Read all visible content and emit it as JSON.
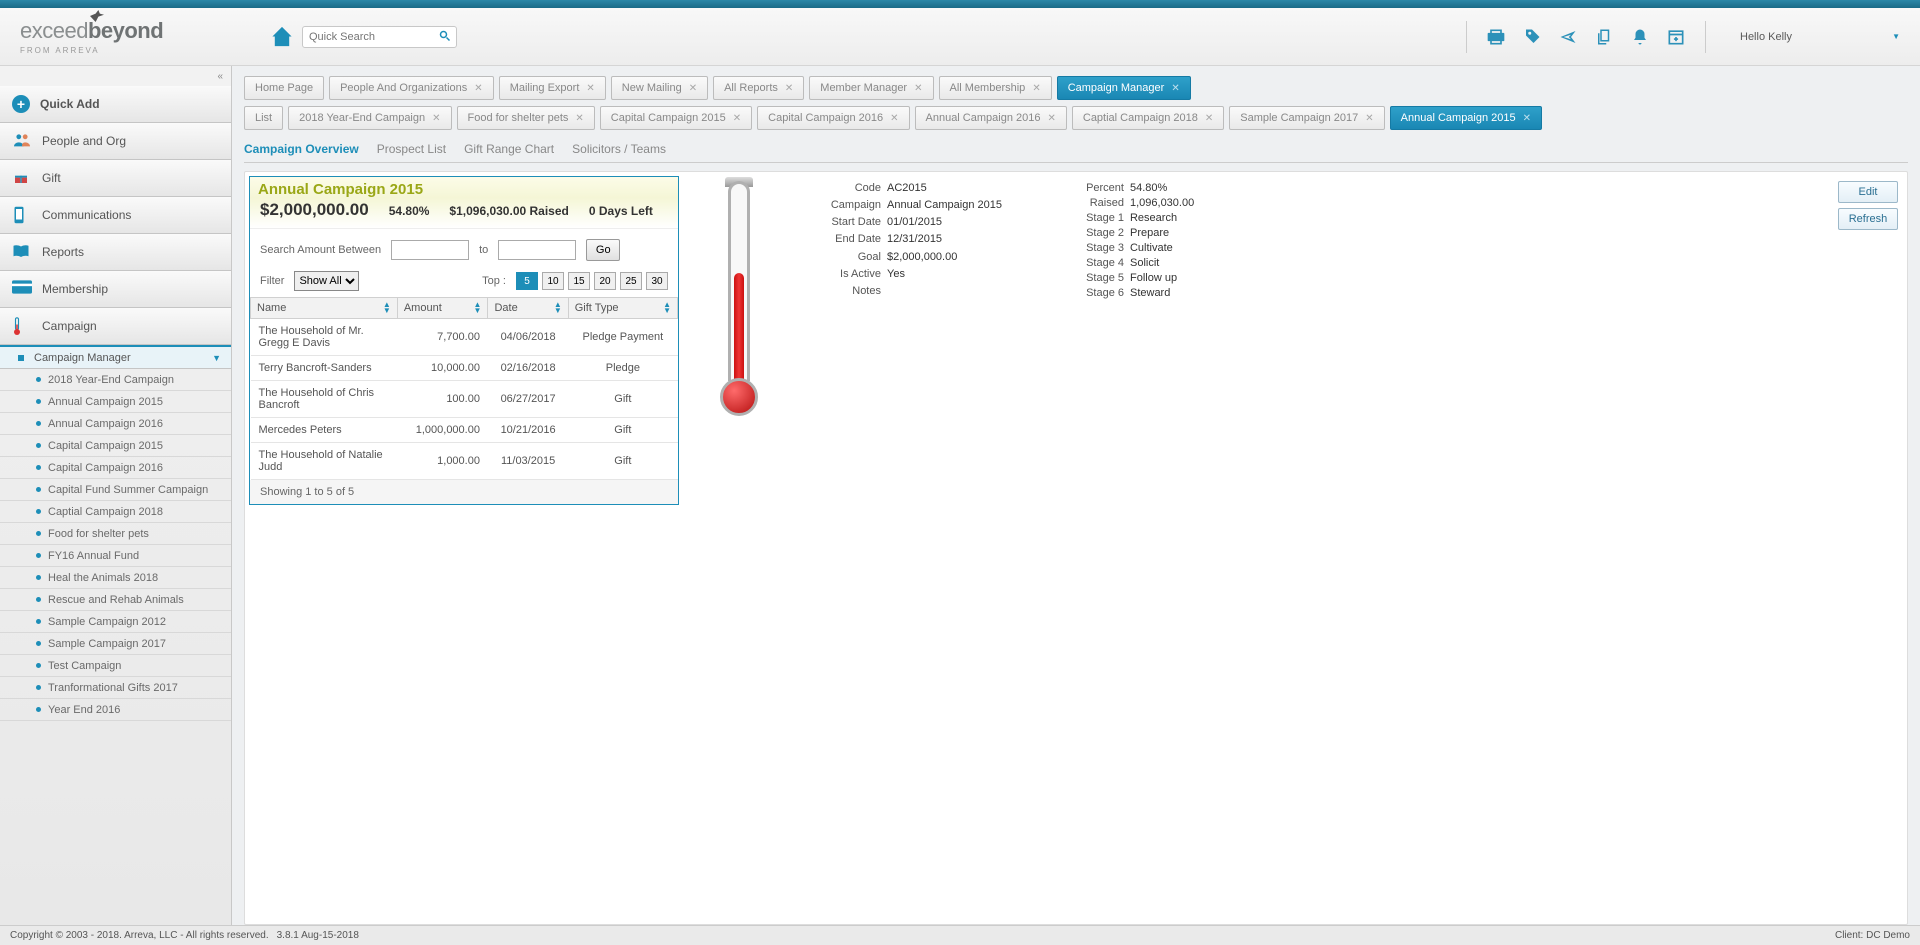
{
  "header": {
    "logo_main_a": "exceed",
    "logo_main_b": "beyond",
    "logo_sub": "FROM ARREVA",
    "search_placeholder": "Quick Search",
    "user_greeting": "Hello Kelly"
  },
  "sidebar": {
    "quick_add": "Quick Add",
    "items": [
      {
        "label": "People and Org"
      },
      {
        "label": "Gift"
      },
      {
        "label": "Communications"
      },
      {
        "label": "Reports"
      },
      {
        "label": "Membership"
      },
      {
        "label": "Campaign"
      }
    ],
    "subnav_header": "Campaign Manager",
    "subnav": [
      "2018 Year-End Campaign",
      "Annual Campaign 2015",
      "Annual Campaign 2016",
      "Capital Campaign 2015",
      "Capital Campaign 2016",
      "Capital Fund Summer Campaign",
      "Captial Campaign 2018",
      "Food for shelter pets",
      "FY16 Annual Fund",
      "Heal the Animals 2018",
      "Rescue and Rehab Animals",
      "Sample Campaign 2012",
      "Sample Campaign 2017",
      "Test Campaign",
      "Tranformational Gifts 2017",
      "Year End 2016"
    ]
  },
  "top_tabs": [
    {
      "label": "Home Page",
      "closable": false
    },
    {
      "label": "People And Organizations",
      "closable": true
    },
    {
      "label": "Mailing Export",
      "closable": true
    },
    {
      "label": "New Mailing",
      "closable": true
    },
    {
      "label": "All Reports",
      "closable": true
    },
    {
      "label": "Member Manager",
      "closable": true
    },
    {
      "label": "All Membership",
      "closable": true
    },
    {
      "label": "Campaign Manager",
      "closable": true,
      "active": true
    }
  ],
  "sub_tabs": [
    {
      "label": "List",
      "closable": false
    },
    {
      "label": "2018 Year-End Campaign",
      "closable": true
    },
    {
      "label": "Food for shelter pets",
      "closable": true
    },
    {
      "label": "Capital Campaign 2015",
      "closable": true
    },
    {
      "label": "Capital Campaign 2016",
      "closable": true
    },
    {
      "label": "Annual Campaign 2016",
      "closable": true
    },
    {
      "label": "Captial Campaign 2018",
      "closable": true
    },
    {
      "label": "Sample Campaign 2017",
      "closable": true
    },
    {
      "label": "Annual Campaign 2015",
      "closable": true,
      "active": true
    }
  ],
  "inner_tabs": [
    {
      "label": "Campaign Overview",
      "active": true
    },
    {
      "label": "Prospect List"
    },
    {
      "label": "Gift Range Chart"
    },
    {
      "label": "Solicitors / Teams"
    }
  ],
  "overview": {
    "title": "Annual Campaign 2015",
    "goal": "$2,000,000.00",
    "percent": "54.80%",
    "raised": "$1,096,030.00 Raised",
    "days_left": "0 Days Left",
    "search_label": "Search Amount Between",
    "to_label": "to",
    "go_label": "Go",
    "filter_label": "Filter",
    "filter_value": "Show All",
    "top_label": "Top :",
    "top_options": [
      "5",
      "10",
      "15",
      "20",
      "25",
      "30"
    ],
    "top_active": "5",
    "columns": [
      "Name",
      "Amount",
      "Date",
      "Gift Type"
    ],
    "rows": [
      {
        "name": "The Household of Mr. Gregg E Davis",
        "amount": "7,700.00",
        "date": "04/06/2018",
        "type": "Pledge Payment"
      },
      {
        "name": "Terry Bancroft-Sanders",
        "amount": "10,000.00",
        "date": "02/16/2018",
        "type": "Pledge"
      },
      {
        "name": "The Household of Chris Bancroft",
        "amount": "100.00",
        "date": "06/27/2017",
        "type": "Gift"
      },
      {
        "name": "Mercedes Peters",
        "amount": "1,000,000.00",
        "date": "10/21/2016",
        "type": "Gift"
      },
      {
        "name": "The Household of Natalie Judd",
        "amount": "1,000.00",
        "date": "11/03/2015",
        "type": "Gift"
      }
    ],
    "footer": "Showing 1 to 5 of 5"
  },
  "details_left": [
    {
      "k": "Code",
      "v": "AC2015"
    },
    {
      "k": "Campaign",
      "v": "Annual Campaign 2015"
    },
    {
      "k": "Start Date",
      "v": "01/01/2015"
    },
    {
      "k": "End Date",
      "v": "12/31/2015"
    },
    {
      "k": "Goal",
      "v": "$2,000,000.00"
    },
    {
      "k": "Is Active",
      "v": "Yes"
    },
    {
      "k": "Notes",
      "v": ""
    }
  ],
  "details_right": [
    {
      "k": "Percent",
      "v": "54.80%"
    },
    {
      "k": "Raised",
      "v": "1,096,030.00"
    },
    {
      "k": "Stage 1",
      "v": "Research"
    },
    {
      "k": "Stage 2",
      "v": "Prepare"
    },
    {
      "k": "Stage 3",
      "v": "Cultivate"
    },
    {
      "k": "Stage 4",
      "v": "Solicit"
    },
    {
      "k": "Stage 5",
      "v": "Follow up"
    },
    {
      "k": "Stage 6",
      "v": "Steward"
    }
  ],
  "actions": {
    "edit": "Edit",
    "refresh": "Refresh"
  },
  "footer": {
    "copyright": "Copyright © 2003 - 2018. Arreva, LLC - All rights reserved.",
    "version": "3.8.1 Aug-15-2018",
    "client": "Client: DC Demo"
  }
}
